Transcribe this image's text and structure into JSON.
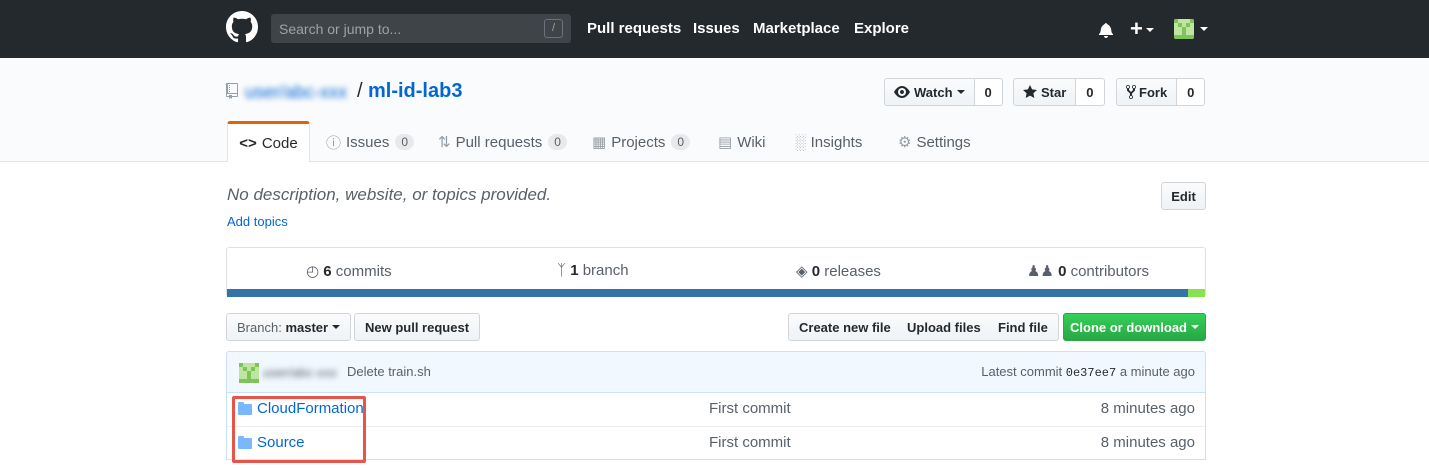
{
  "header": {
    "search_placeholder": "Search or jump to...",
    "slash_key": "/",
    "nav": [
      "Pull requests",
      "Issues",
      "Marketplace",
      "Explore"
    ],
    "plus": "+"
  },
  "repo": {
    "owner": "user/abc-xxx",
    "separator": "/",
    "name": "ml-id-lab3",
    "watch_label": "Watch",
    "watch_count": "0",
    "star_label": "Star",
    "star_count": "0",
    "fork_label": "Fork",
    "fork_count": "0"
  },
  "tabs": [
    {
      "label": "Code",
      "icon": "code-icon"
    },
    {
      "label": "Issues",
      "count": "0",
      "icon": "issue-icon"
    },
    {
      "label": "Pull requests",
      "count": "0",
      "icon": "pull-request-icon"
    },
    {
      "label": "Projects",
      "count": "0",
      "icon": "project-icon"
    },
    {
      "label": "Wiki",
      "icon": "book-icon"
    },
    {
      "label": "Insights",
      "icon": "graph-icon"
    },
    {
      "label": "Settings",
      "icon": "gear-icon"
    }
  ],
  "description": "No description, website, or topics provided.",
  "add_topics": "Add topics",
  "edit_label": "Edit",
  "summary": {
    "commits_num": "6",
    "commits_label": "commits",
    "branch_num": "1",
    "branch_label": "branch",
    "releases_num": "0",
    "releases_label": "releases",
    "contributors_num": "0",
    "contributors_label": "contributors"
  },
  "language_bar": [
    {
      "color": "#3572A5",
      "share": 0.983
    },
    {
      "color": "#89e051",
      "share": 0.017
    }
  ],
  "toolbar": {
    "branch_prefix": "Branch:",
    "branch_name": "master",
    "new_pr": "New pull request",
    "create_file": "Create new file",
    "upload_files": "Upload files",
    "find_file": "Find file",
    "clone": "Clone or download"
  },
  "latest_commit": {
    "author": "user/abc-xxx",
    "message": "Delete train.sh",
    "latest_label": "Latest commit",
    "sha": "0e37ee7",
    "age": "a minute ago"
  },
  "files": [
    {
      "name": "CloudFormation",
      "message": "First commit",
      "age": "8 minutes ago"
    },
    {
      "name": "Source",
      "message": "First commit",
      "age": "8 minutes ago"
    }
  ],
  "colors": {
    "accent": "#0366d6",
    "highlight": "#e8534a",
    "green": "#28a745"
  }
}
